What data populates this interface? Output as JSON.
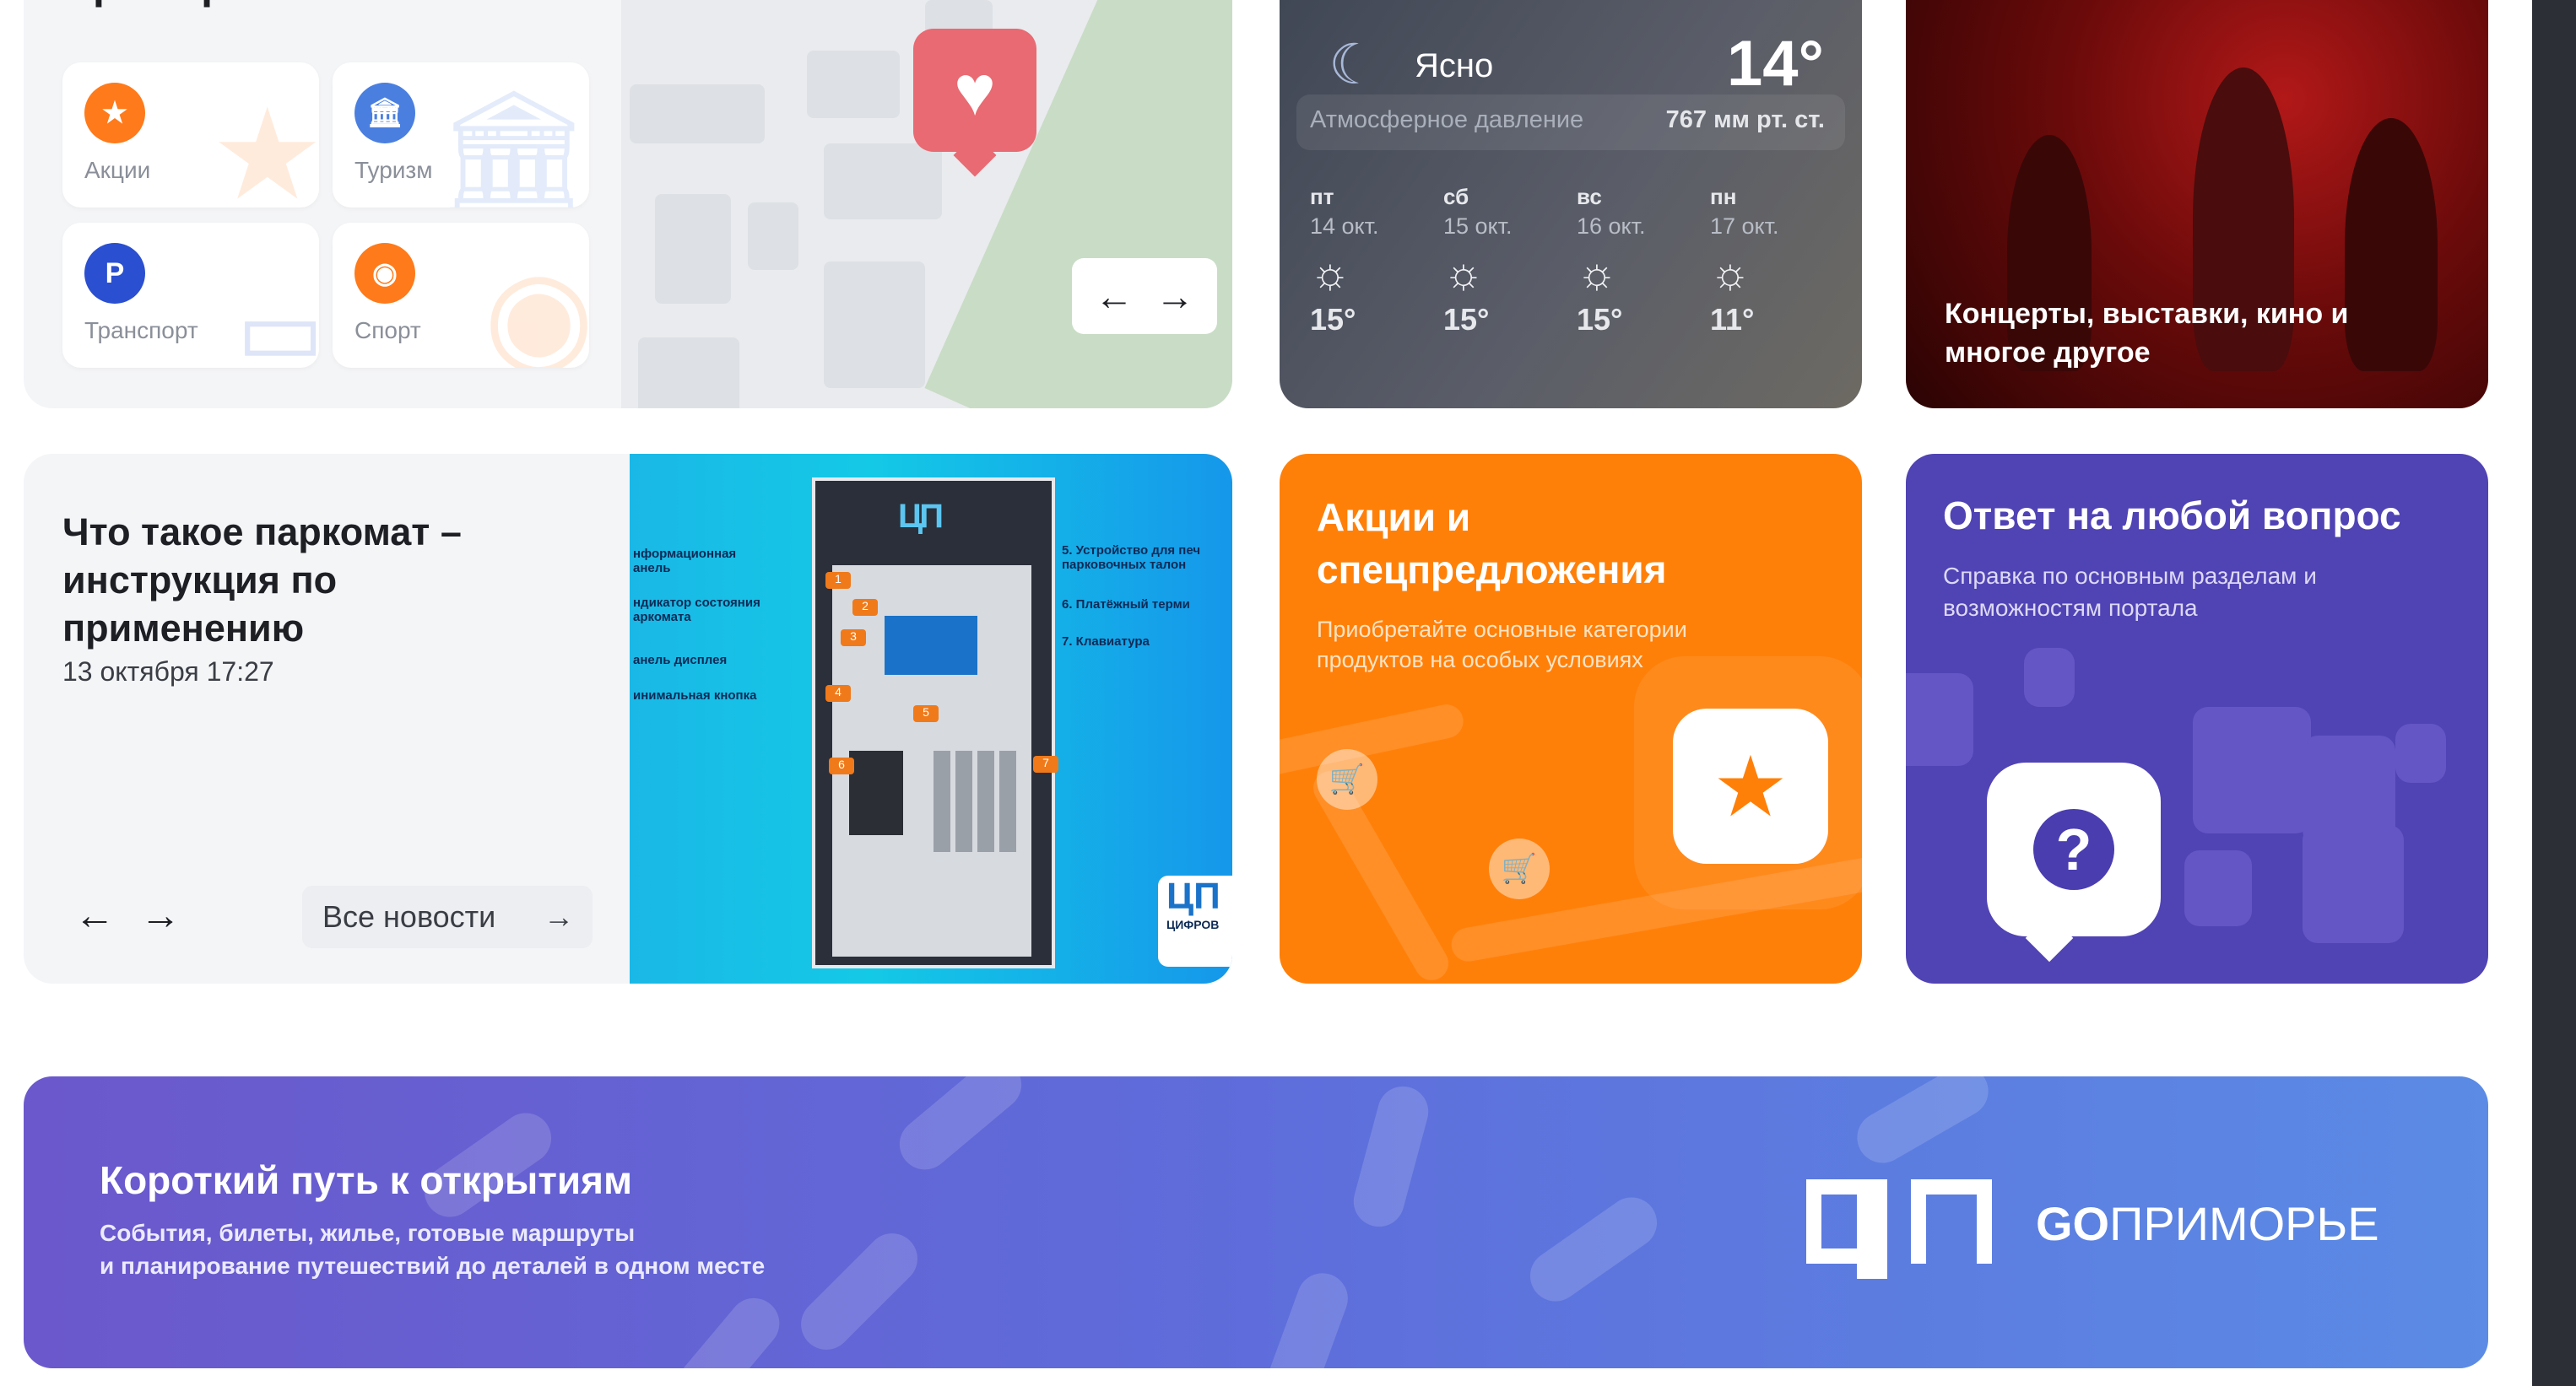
{
  "services": {
    "title": "Приморья",
    "tiles": [
      {
        "label": "Акции",
        "icon": "star-icon",
        "color": "#ff7a1a"
      },
      {
        "label": "Туризм",
        "icon": "museum-icon",
        "color": "#4a7fe0"
      },
      {
        "label": "Транспорт",
        "icon": "parking-icon",
        "color": "#2a4fd0"
      },
      {
        "label": "Спорт",
        "icon": "ball-icon",
        "color": "#ff7a1a"
      }
    ],
    "map_nav": {
      "prev": "←",
      "next": "→"
    }
  },
  "weather": {
    "condition": "Ясно",
    "temp": "14°",
    "pressure_label": "Атмосферное давление",
    "pressure_value": "767 мм рт. ст.",
    "days": [
      {
        "day": "пт",
        "date": "14 окт.",
        "temp": "15°"
      },
      {
        "day": "сб",
        "date": "15 окт.",
        "temp": "15°"
      },
      {
        "day": "вс",
        "date": "16 окт.",
        "temp": "15°"
      },
      {
        "day": "пн",
        "date": "17 окт.",
        "temp": "11°"
      }
    ]
  },
  "events": {
    "text": "Концерты, выставки, кино и многое другое"
  },
  "news": {
    "title": "Что такое паркомат – инструкция по применению",
    "date": "13 октября 17:27",
    "prev": "←",
    "next": "→",
    "all_label": "Все новости",
    "all_arrow": "→",
    "image_labels_left": [
      "нформационная анель",
      "ндикатор состояния аркомата",
      "анель дисплея",
      "инимальная кнопка"
    ],
    "image_labels_right": [
      "5. Устройство для печ парковочных талон",
      "6. Платёжный терми",
      "7. Клавиатура"
    ],
    "image_brand": "ЦИФРОВ"
  },
  "promo": {
    "title": "Акции и спецпредложения",
    "subtitle": "Приобретайте основные категории продуктов на особых условиях"
  },
  "faq": {
    "title": "Ответ на любой вопрос",
    "subtitle": "Справка по основным разделам и возможностям портала",
    "symbol": "?"
  },
  "banner": {
    "title": "Короткий путь к открытиям",
    "subtitle_line1": "События, билеты, жилье, готовые маршруты",
    "subtitle_line2": "и планирование путешествий до деталей в одном месте",
    "brand_go": "GO",
    "brand_name": "ПРИМОРЬЕ"
  }
}
